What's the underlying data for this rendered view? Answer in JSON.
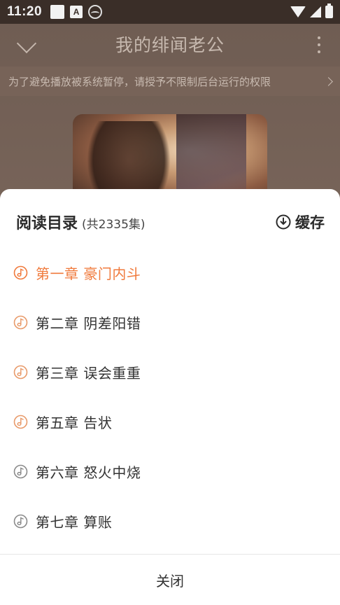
{
  "status_bar": {
    "time": "11:20",
    "left_icons": [
      "notification-square-icon",
      "a-icon",
      "avatar-face-icon"
    ],
    "right_icons": [
      "wifi-icon",
      "signal-icon",
      "battery-icon"
    ],
    "a_glyph": "A"
  },
  "header": {
    "title": "我的绯闻老公"
  },
  "notice": {
    "text": "为了避免播放被系统暂停，请授予不限制后台运行的权限"
  },
  "sheet": {
    "title": "阅读目录",
    "count": "(共2335集)",
    "cache_label": "缓存"
  },
  "chapters": [
    {
      "label": "第一章 豪门内斗",
      "state": "playing"
    },
    {
      "label": "第二章 阴差阳错",
      "state": "played"
    },
    {
      "label": "第三章 误会重重",
      "state": "played"
    },
    {
      "label": "第五章 告状",
      "state": "played"
    },
    {
      "label": "第六章 怒火中烧",
      "state": "unplayed"
    },
    {
      "label": "第七章 算账",
      "state": "unplayed"
    }
  ],
  "close_label": "关闭",
  "colors": {
    "accent": "#f07a3c",
    "played_icon": "#e89a6a",
    "unplayed": "#8a8a8a",
    "text": "#333333"
  }
}
